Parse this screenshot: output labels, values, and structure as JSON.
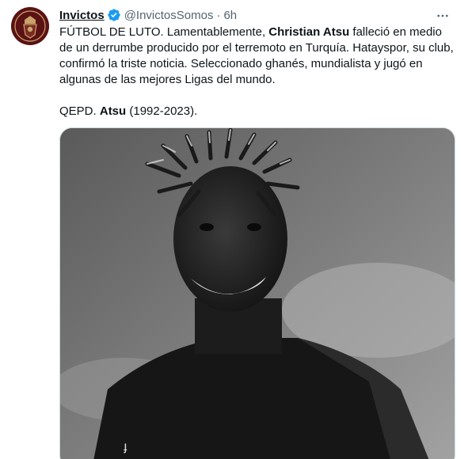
{
  "author": {
    "display_name": "Invictos",
    "handle": "@InvictosSomos",
    "separator": "·",
    "time": "6h",
    "verified_icon": "verified-badge-icon"
  },
  "menu_icon": "more-options-icon",
  "tweet": {
    "line1_a": "FÚTBOL DE LUTO. Lamentablemente, ",
    "line1_bold": "Christian Atsu",
    "line1_b": " falleció en medio de un derrumbe producido por el terremoto en Turquía. Hatayspor, su club, confirmó la triste noticia. Seleccionado ghanés, mundialista y jugó en algunas de las mejores Ligas del mundo.",
    "line2_a": "QEPD. ",
    "line2_bold": "Atsu",
    "line2_b": " (1992-2023)."
  },
  "media": {
    "kind": "black-and-white photo of a smiling football player with dreadlocks"
  }
}
